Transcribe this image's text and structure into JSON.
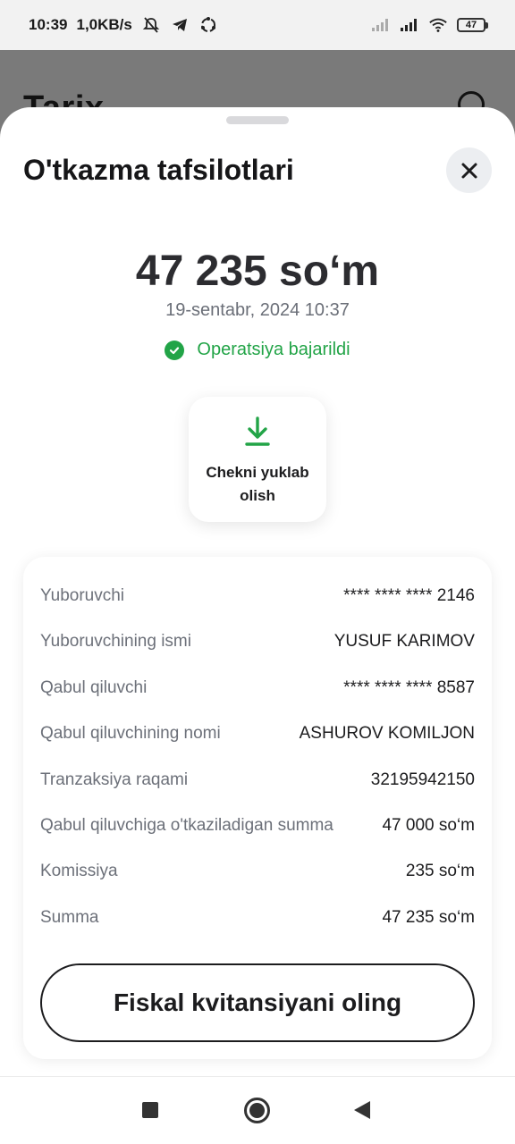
{
  "status_bar": {
    "time": "10:39",
    "speed": "1,0KB/s",
    "battery": "47",
    "icons": [
      "bell-off-icon",
      "telegram-icon",
      "sync-icon",
      "signal-icon",
      "signal-icon",
      "wifi-icon",
      "battery-icon"
    ]
  },
  "background": {
    "title": "Tarix",
    "search_icon": "search-icon"
  },
  "sheet": {
    "title": "O'tkazma tafsilotlari",
    "close_icon": "close-icon",
    "amount": "47 235 so‘m",
    "date": "19-sentabr, 2024 10:37",
    "status": "Operatsiya bajarildi",
    "status_color": "#22a447",
    "download_label": "Chekni yuklab olish",
    "download_icon": "download-icon",
    "details": [
      {
        "label": "Yuboruvchi",
        "value": "**** **** **** 2146"
      },
      {
        "label": "Yuboruvchining ismi",
        "value": "YUSUF KARIMOV"
      },
      {
        "label": "Qabul qiluvchi",
        "value": "**** **** **** 8587"
      },
      {
        "label": "Qabul qiluvchining nomi",
        "value": "ASHUROV KOMILJON"
      },
      {
        "label": "Tranzaksiya raqami",
        "value": "32195942150"
      },
      {
        "label": "Qabul qiluvchiga o'tkaziladigan summa",
        "value": "47 000 so‘m"
      },
      {
        "label": "Komissiya",
        "value": "235 so‘m"
      },
      {
        "label": "Summa",
        "value": "47 235 so‘m"
      }
    ],
    "fiscal_button": "Fiskal kvitansiyani oling"
  },
  "navbar": {
    "icons": [
      "recents-icon",
      "home-icon",
      "back-icon"
    ]
  }
}
